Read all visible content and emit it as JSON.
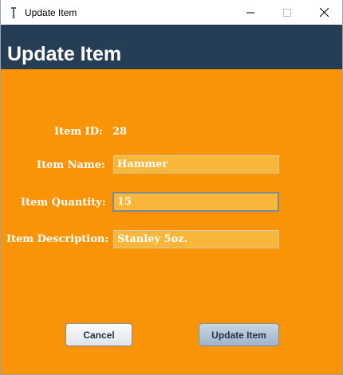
{
  "window": {
    "title": "Update Item"
  },
  "header": {
    "title": "Update Item"
  },
  "form": {
    "item_id": {
      "label": "Item ID:",
      "value": "28"
    },
    "item_name": {
      "label": "Item Name:",
      "value": "Hammer"
    },
    "item_quantity": {
      "label": "Item Quantity:",
      "value": "15"
    },
    "item_description": {
      "label": "Item Description:",
      "value": "Stanley 5oz."
    }
  },
  "buttons": {
    "cancel": "Cancel",
    "update": "Update Item"
  },
  "colors": {
    "background": "#f89406",
    "header": "#263d56",
    "field": "#f8b73a"
  },
  "icons": {
    "app": "java-duke-icon",
    "minimize": "minimize-icon",
    "maximize": "maximize-icon",
    "close": "close-icon"
  }
}
